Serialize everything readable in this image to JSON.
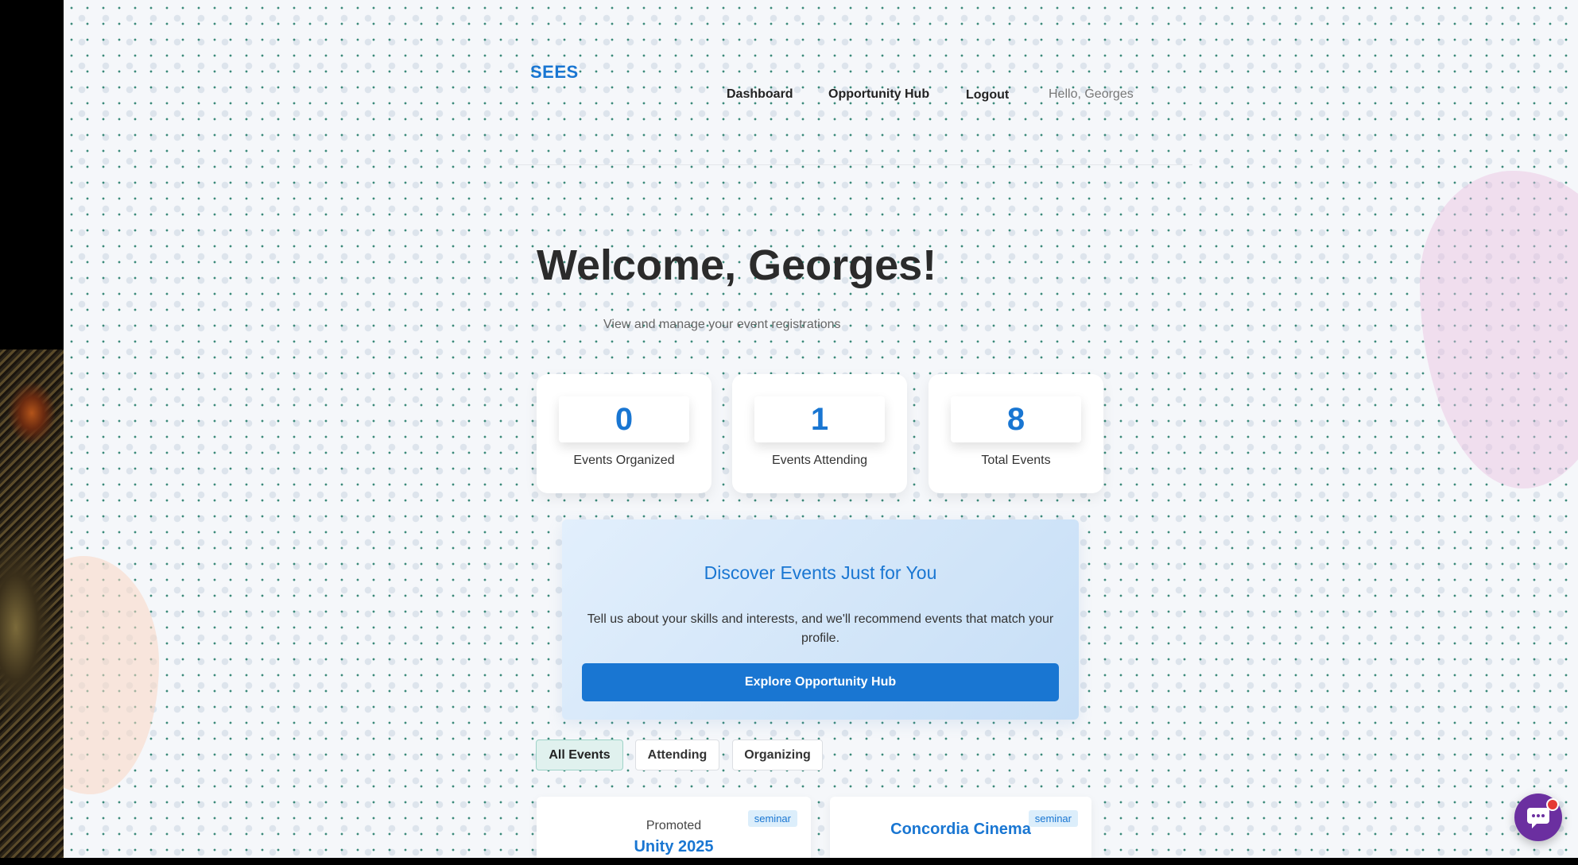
{
  "brand": {
    "logo": "SEES",
    "accent": "#1976d2"
  },
  "nav": {
    "dashboard": "Dashboard",
    "opportunity_hub": "Opportunity Hub",
    "logout": "Logout",
    "greeting": "Hello, Georges"
  },
  "hero": {
    "title": "Welcome, Georges!",
    "subtitle": "View and manage your event registrations"
  },
  "stats": [
    {
      "value": "0",
      "label": "Events Organized"
    },
    {
      "value": "1",
      "label": "Events Attending"
    },
    {
      "value": "8",
      "label": "Total Events"
    }
  ],
  "discover": {
    "title": "Discover Events Just for You",
    "text": "Tell us about your skills and interests, and we'll recommend events that match your profile.",
    "button": "Explore Opportunity Hub"
  },
  "filters": {
    "all": "All Events",
    "attending": "Attending",
    "organizing": "Organizing",
    "active": "All Events"
  },
  "events": [
    {
      "badge": "Promoted",
      "title": "Unity 2025",
      "tag": "seminar"
    },
    {
      "title": "Concordia Cinema",
      "tag": "seminar"
    }
  ],
  "chat": {
    "icon": "chat-bubble-icon"
  }
}
